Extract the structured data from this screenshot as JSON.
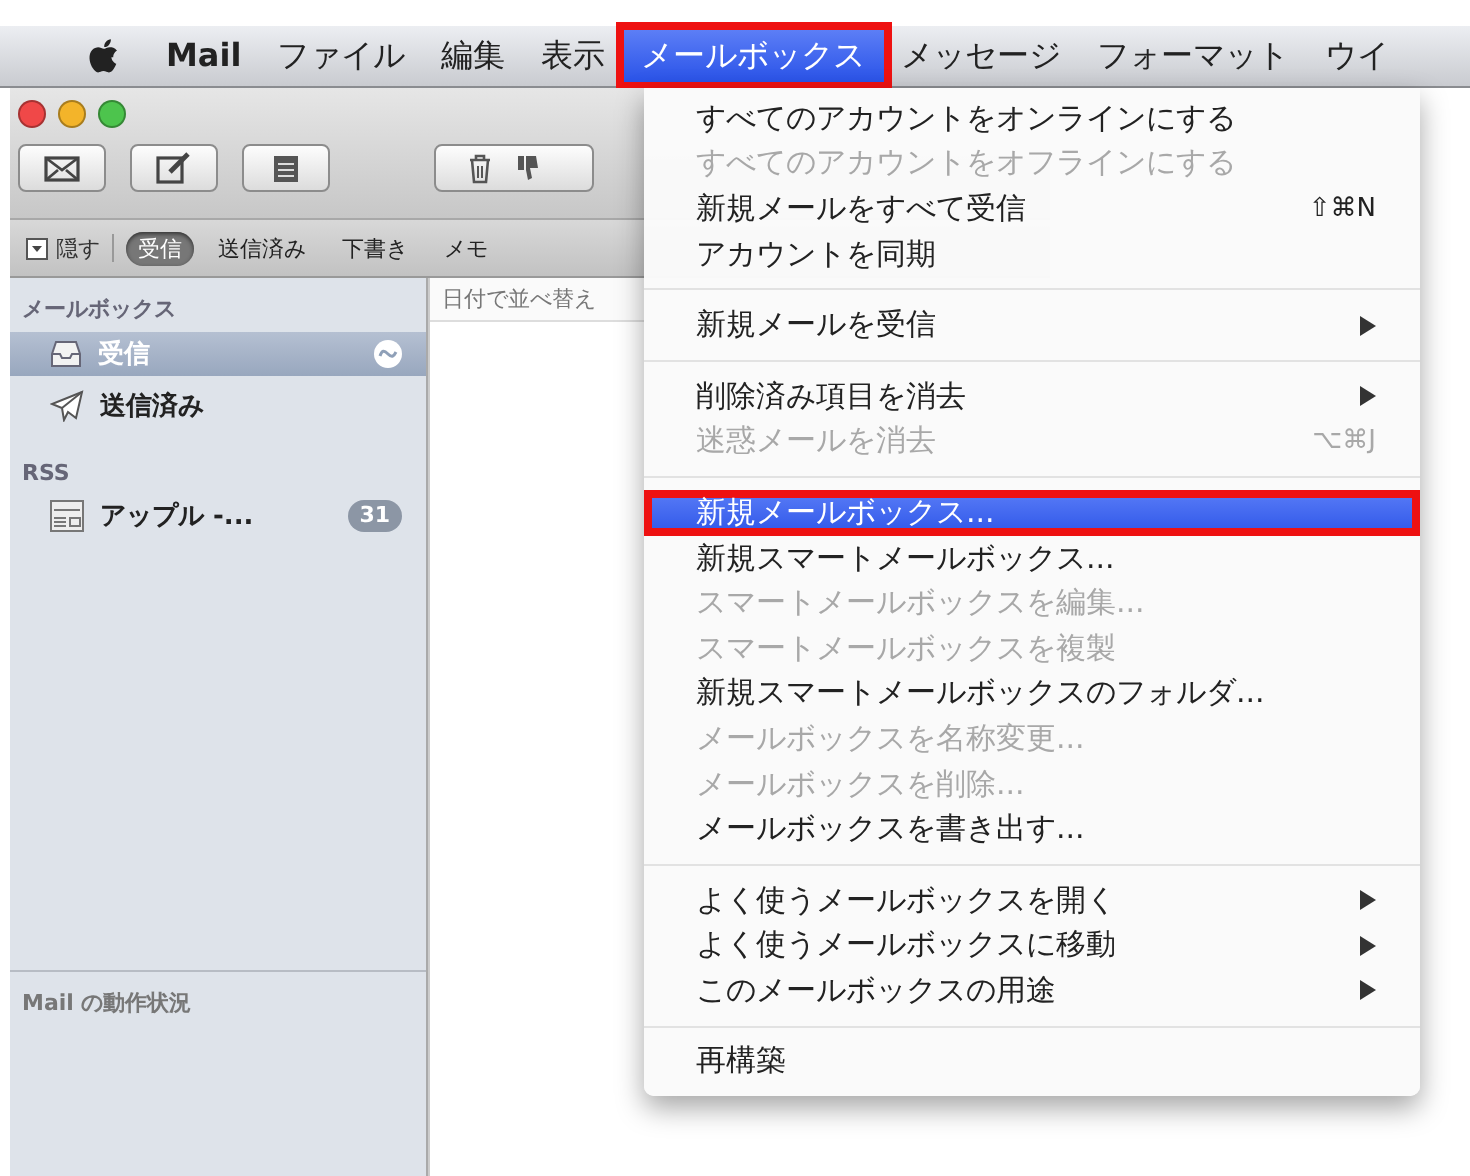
{
  "menu_bar": {
    "items": [
      {
        "label": "Mail",
        "kind": "app",
        "selected": false,
        "outlined": false
      },
      {
        "label": "ファイル",
        "kind": "menu",
        "selected": false,
        "outlined": false
      },
      {
        "label": "編集",
        "kind": "menu",
        "selected": false,
        "outlined": false
      },
      {
        "label": "表示",
        "kind": "menu",
        "selected": false,
        "outlined": false
      },
      {
        "label": "メールボックス",
        "kind": "menu",
        "selected": true,
        "outlined": true
      },
      {
        "label": "メッセージ",
        "kind": "menu",
        "selected": false,
        "outlined": false
      },
      {
        "label": "フォーマット",
        "kind": "menu",
        "selected": false,
        "outlined": false
      },
      {
        "label": "ウイ",
        "kind": "menu",
        "selected": false,
        "outlined": false
      }
    ]
  },
  "favorites_bar": {
    "hide_label": "隠す",
    "items": [
      {
        "label": "受信",
        "selected": true
      },
      {
        "label": "送信済み",
        "selected": false
      },
      {
        "label": "下書き",
        "selected": false
      },
      {
        "label": "メモ",
        "selected": false
      }
    ]
  },
  "sidebar": {
    "sections": [
      {
        "title": "メールボックス",
        "items": [
          {
            "label": "受信",
            "kind": "inbox",
            "selected": true,
            "activity": true
          },
          {
            "label": "送信済み",
            "kind": "sent",
            "selected": false,
            "activity": false
          }
        ]
      },
      {
        "title": "RSS",
        "items": [
          {
            "label": "アップル -...",
            "kind": "feed",
            "selected": false,
            "activity": false,
            "count": "31"
          }
        ]
      }
    ],
    "activity_title": "Mail の動作状況"
  },
  "message_list": {
    "sort_label": "日付で並べ替え"
  },
  "menu": {
    "groups": [
      [
        {
          "label": "すべてのアカウントをオンラインにする",
          "disabled": false,
          "submenu": false,
          "selected": false,
          "outlined": false
        },
        {
          "label": "すべてのアカウントをオフラインにする",
          "disabled": true,
          "submenu": false,
          "selected": false,
          "outlined": false
        },
        {
          "label": "新規メールをすべて受信",
          "shortcut": "⇧⌘N",
          "disabled": false,
          "submenu": false,
          "selected": false,
          "outlined": false
        },
        {
          "label": "アカウントを同期",
          "disabled": false,
          "submenu": false,
          "selected": false,
          "outlined": false
        }
      ],
      [
        {
          "label": "新規メールを受信",
          "disabled": false,
          "submenu": true,
          "selected": false,
          "outlined": false
        }
      ],
      [
        {
          "label": "削除済み項目を消去",
          "disabled": false,
          "submenu": true,
          "selected": false,
          "outlined": false
        },
        {
          "label": "迷惑メールを消去",
          "shortcut": "⌥⌘J",
          "disabled": true,
          "submenu": false,
          "selected": false,
          "outlined": false
        }
      ],
      [
        {
          "label": "新規メールボックス...",
          "disabled": false,
          "submenu": false,
          "selected": true,
          "outlined": true
        },
        {
          "label": "新規スマートメールボックス...",
          "disabled": false,
          "submenu": false,
          "selected": false,
          "outlined": false
        },
        {
          "label": "スマートメールボックスを編集...",
          "disabled": true,
          "submenu": false,
          "selected": false,
          "outlined": false
        },
        {
          "label": "スマートメールボックスを複製",
          "disabled": true,
          "submenu": false,
          "selected": false,
          "outlined": false
        },
        {
          "label": "新規スマートメールボックスのフォルダ...",
          "disabled": false,
          "submenu": false,
          "selected": false,
          "outlined": false
        },
        {
          "label": "メールボックスを名称変更...",
          "disabled": true,
          "submenu": false,
          "selected": false,
          "outlined": false
        },
        {
          "label": "メールボックスを削除...",
          "disabled": true,
          "submenu": false,
          "selected": false,
          "outlined": false
        },
        {
          "label": "メールボックスを書き出す...",
          "disabled": false,
          "submenu": false,
          "selected": false,
          "outlined": false
        }
      ],
      [
        {
          "label": "よく使うメールボックスを開く",
          "disabled": false,
          "submenu": true,
          "selected": false,
          "outlined": false
        },
        {
          "label": "よく使うメールボックスに移動",
          "disabled": false,
          "submenu": true,
          "selected": false,
          "outlined": false
        },
        {
          "label": "このメールボックスの用途",
          "disabled": false,
          "submenu": true,
          "selected": false,
          "outlined": false
        }
      ],
      [
        {
          "label": "再構築",
          "disabled": false,
          "submenu": false,
          "selected": false,
          "outlined": false
        }
      ]
    ]
  }
}
